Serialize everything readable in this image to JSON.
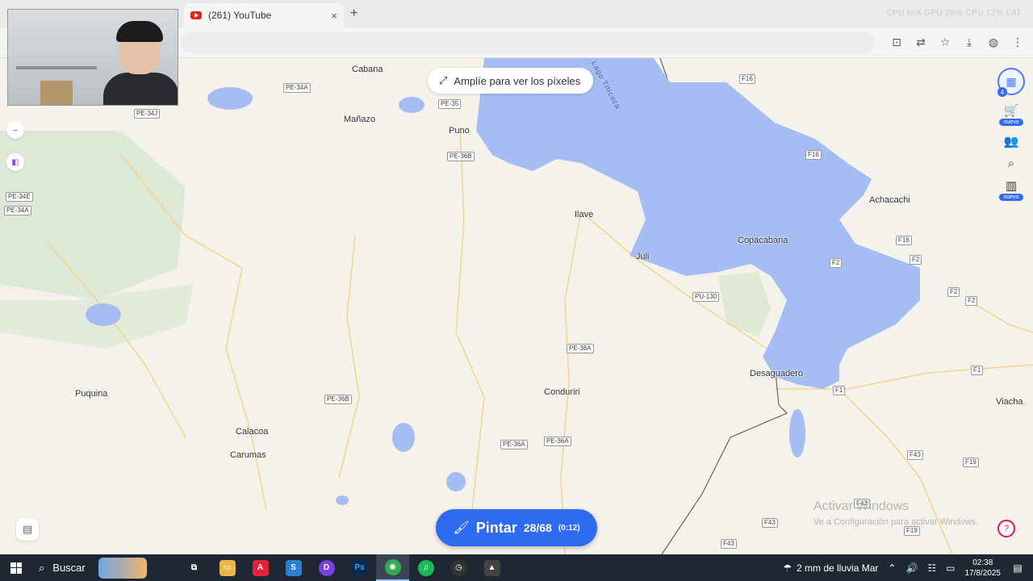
{
  "browser": {
    "tab_title": "(261) YouTube",
    "tab_close": "×",
    "new_tab": "+",
    "sysmon": "CPU N/A   GPU 28%   CPU 12%   LAT",
    "window_controls": [
      "—",
      "❐",
      "✕"
    ],
    "toolbar_icons": [
      "install-icon",
      "translate-icon",
      "star-icon",
      "download-icon",
      "profile-icon",
      "menu-icon"
    ]
  },
  "map": {
    "zoom_hint": "Amplíe para ver los píxeles",
    "lake_label": "Lago Titicaca",
    "cities": [
      {
        "id": "cabana",
        "name": "Cabana"
      },
      {
        "id": "manazo",
        "name": "Mañazo"
      },
      {
        "id": "puno",
        "name": "Puno"
      },
      {
        "id": "ilave",
        "name": "Ilave"
      },
      {
        "id": "juli",
        "name": "Juli"
      },
      {
        "id": "copacabana",
        "name": "Copacabana"
      },
      {
        "id": "achacachi",
        "name": "Achacachi"
      },
      {
        "id": "desaguadero",
        "name": "Desaguadero"
      },
      {
        "id": "conduriri",
        "name": "Conduriri"
      },
      {
        "id": "puquina",
        "name": "Puquina"
      },
      {
        "id": "calacoa",
        "name": "Calacoa"
      },
      {
        "id": "carumas",
        "name": "Carumas"
      },
      {
        "id": "viacha",
        "name": "Viacha"
      }
    ],
    "roads": [
      {
        "id": "pe34a_top",
        "name": "PE-34A"
      },
      {
        "id": "pe34j",
        "name": "PE-34J"
      },
      {
        "id": "pe35",
        "name": "PE-35"
      },
      {
        "id": "pe36b_top",
        "name": "PE-36B"
      },
      {
        "id": "pe34e",
        "name": "PE-34E"
      },
      {
        "id": "pe34a_left",
        "name": "PE-34A"
      },
      {
        "id": "f16_a",
        "name": "F16"
      },
      {
        "id": "f16_b",
        "name": "F16"
      },
      {
        "id": "f16_c",
        "name": "F16"
      },
      {
        "id": "f2_a",
        "name": "F2"
      },
      {
        "id": "f2_b",
        "name": "F2"
      },
      {
        "id": "f2_c",
        "name": "F2"
      },
      {
        "id": "f2_d",
        "name": "F2"
      },
      {
        "id": "pu130",
        "name": "PU-130"
      },
      {
        "id": "pe38a",
        "name": "PE-38A"
      },
      {
        "id": "f1_a",
        "name": "F1"
      },
      {
        "id": "f1_b",
        "name": "F1"
      },
      {
        "id": "pe36b_low",
        "name": "PE-36B"
      },
      {
        "id": "pe36a_a",
        "name": "PE-36A"
      },
      {
        "id": "pe36a_b",
        "name": "PE-36A"
      },
      {
        "id": "f43_a",
        "name": "F43"
      },
      {
        "id": "f19_a",
        "name": "F19"
      },
      {
        "id": "f43_b",
        "name": "F43"
      },
      {
        "id": "f43_c",
        "name": "F43"
      },
      {
        "id": "f43_d",
        "name": "F43"
      },
      {
        "id": "f19_b",
        "name": "F19"
      }
    ],
    "right_rail": [
      {
        "id": "store",
        "icon": "cart-icon",
        "glyph": "🛒",
        "badge": "nuevo"
      },
      {
        "id": "people",
        "icon": "group-icon",
        "glyph": "👥",
        "badge": ""
      },
      {
        "id": "search",
        "icon": "map-search-icon",
        "glyph": "⌕",
        "badge": ""
      },
      {
        "id": "stats",
        "icon": "leaderboard-icon",
        "glyph": "▥",
        "badge": "nuevo"
      }
    ],
    "logo_count": "4",
    "paint_button": {
      "label": "Pintar",
      "count": "28/68",
      "timer": "(0:12)"
    }
  },
  "watermark": {
    "title": "Activar Windows",
    "subtitle": "Ve a Configuración para activar Windows."
  },
  "taskbar": {
    "search_label": "Buscar",
    "weather": "2 mm de lluvia Mar",
    "time": "02:38",
    "date": "17/8/2025",
    "apps": [
      {
        "id": "taskview",
        "glyph": "⧉",
        "color": "#1f2733"
      },
      {
        "id": "explorer",
        "glyph": "▭",
        "color": "#e8b64a"
      },
      {
        "id": "app-red",
        "glyph": "A",
        "color": "#e0243c"
      },
      {
        "id": "app-blue",
        "glyph": "S",
        "color": "#2a7fd4"
      },
      {
        "id": "app-purple",
        "glyph": "D",
        "color": "#7b3fe4"
      },
      {
        "id": "photoshop",
        "glyph": "Ps",
        "color": "#0a2a4a"
      },
      {
        "id": "chrome",
        "glyph": "◉",
        "color": "#34a853"
      },
      {
        "id": "spotify",
        "glyph": "♫",
        "color": "#1db954"
      },
      {
        "id": "app-clock",
        "glyph": "◷",
        "color": "#333"
      },
      {
        "id": "photos",
        "glyph": "▲",
        "color": "#444"
      }
    ]
  }
}
